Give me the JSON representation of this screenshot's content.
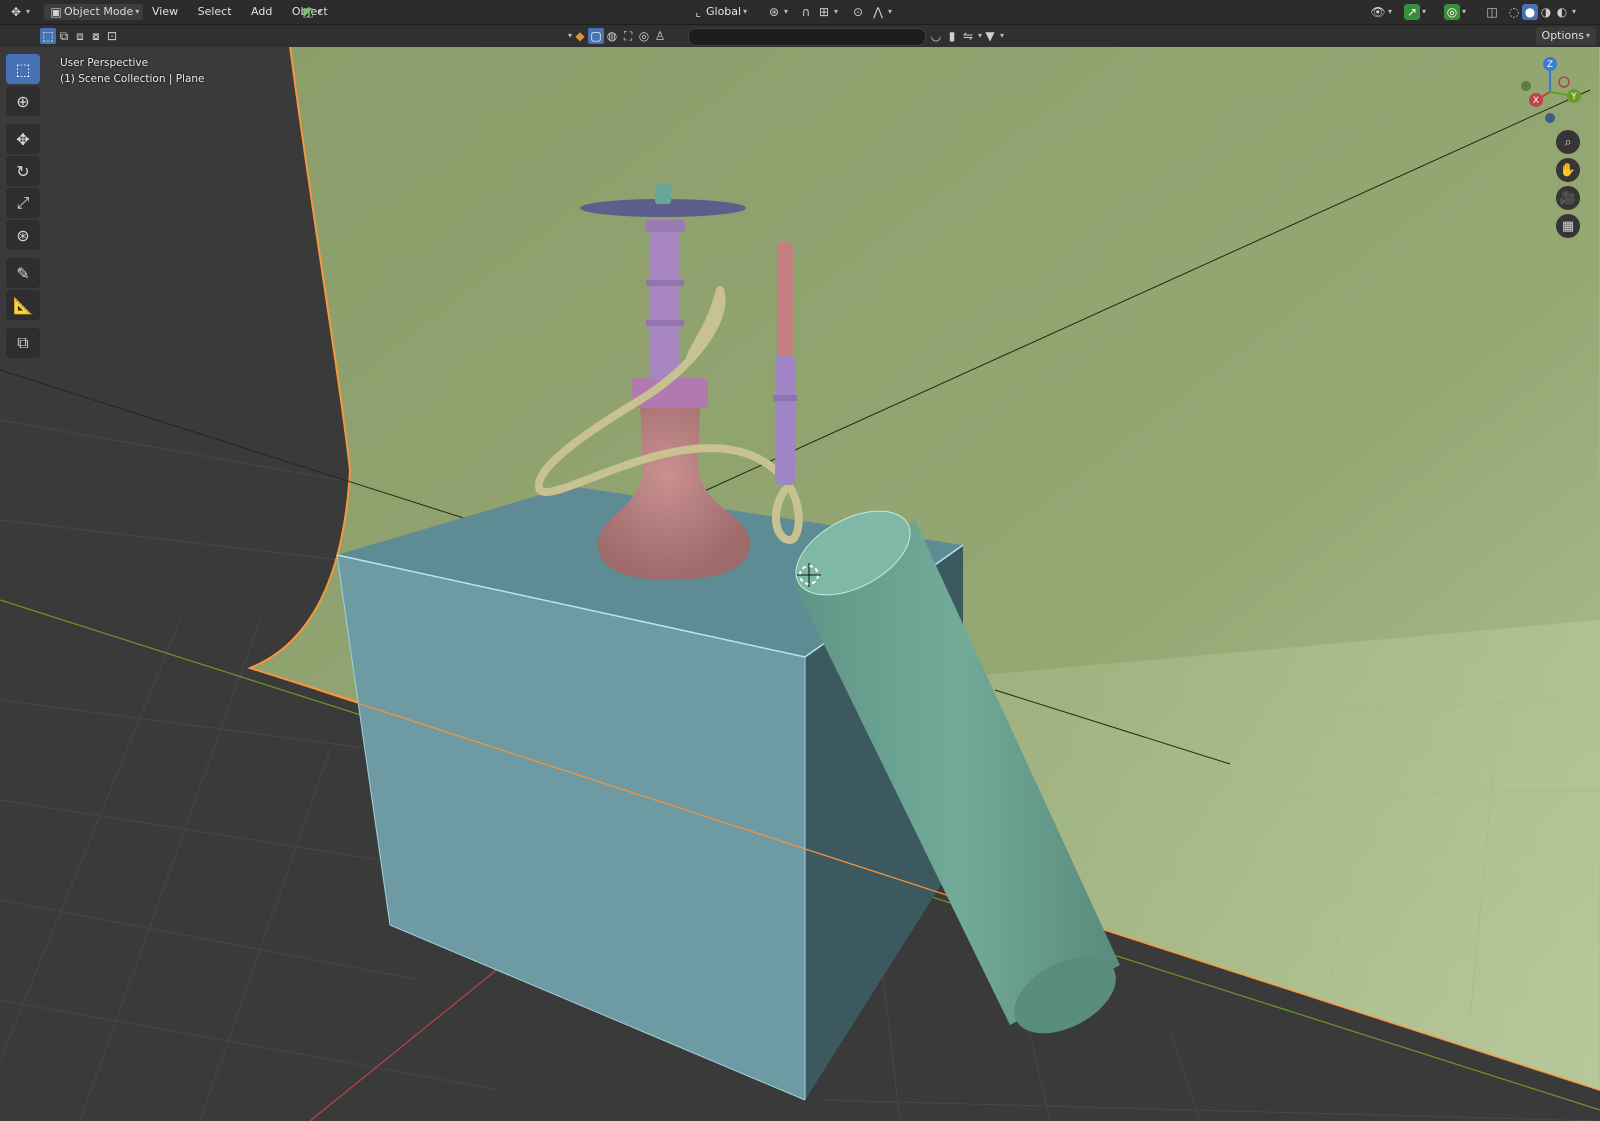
{
  "header": {
    "mode": "Object Mode",
    "menus": [
      "View",
      "Select",
      "Add",
      "Object"
    ],
    "transform_orientation": "Global",
    "options_label": "Options"
  },
  "viewport": {
    "perspective_label": "User Perspective",
    "scene_info": "(1) Scene Collection | Plane"
  },
  "toolbar": {
    "tools": [
      "select-box",
      "cursor",
      "move",
      "rotate",
      "scale",
      "transform",
      "annotate",
      "measure",
      "add-cube"
    ],
    "active": "select-box"
  },
  "gizmo": {
    "axes": [
      "X",
      "Y",
      "Z"
    ]
  },
  "colors": {
    "header_bg": "#2b2b2b",
    "viewport_bg": "#3a3a3a",
    "active_tool": "#4772b3",
    "backdrop": "#8da26d",
    "cube": "#6d97a0",
    "cylinder": "#6ea594",
    "hookah_base": "#b77c7c",
    "hookah_stem": "#a886c0",
    "hose": "#c8c191",
    "selection_outline": "#f7963c",
    "axis_x": "#c0424a",
    "axis_y": "#6a9a2a",
    "axis_z": "#3a7bd5"
  }
}
